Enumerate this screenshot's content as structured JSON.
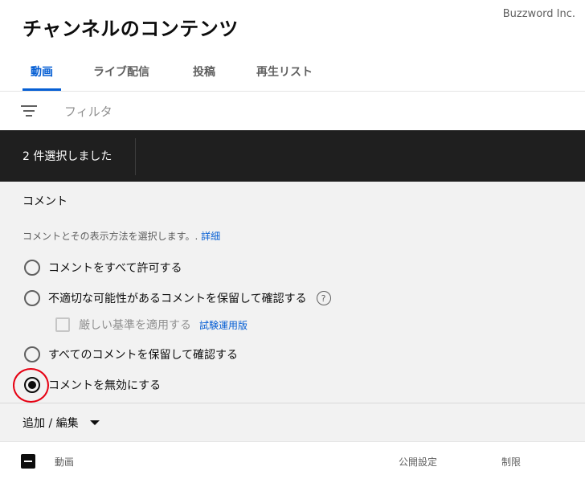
{
  "watermark": "Buzzword Inc.",
  "page_title": "チャンネルのコンテンツ",
  "tabs": [
    {
      "label": "動画",
      "active": true
    },
    {
      "label": "ライブ配信",
      "active": false
    },
    {
      "label": "投稿",
      "active": false
    },
    {
      "label": "再生リスト",
      "active": false
    }
  ],
  "filter": {
    "icon": "filter-icon",
    "placeholder": "フィルタ"
  },
  "selection": {
    "text": "2 件選択しました"
  },
  "comments_panel": {
    "title": "コメント",
    "description": "コメントとその表示方法を選択します。.",
    "details_link": "詳細",
    "options": [
      {
        "label": "コメントをすべて許可する",
        "checked": false
      },
      {
        "label": "不適切な可能性があるコメントを保留して確認する",
        "checked": false
      },
      {
        "label": "すべてのコメントを保留して確認する",
        "checked": false
      },
      {
        "label": "コメントを無効にする",
        "checked": true
      }
    ],
    "strict_option": {
      "label": "厳しい基準を適用する",
      "badge": "試験運用版",
      "checked": false
    },
    "help_icon": "help-icon"
  },
  "edit": {
    "label": "追加 / 編集"
  },
  "table": {
    "columns": [
      "動画",
      "公開設定",
      "制限"
    ]
  },
  "colors": {
    "accent": "#065fd4",
    "selection_bar": "#1f1f1f",
    "panel": "#f2f2f2",
    "highlight": "#e60012"
  }
}
